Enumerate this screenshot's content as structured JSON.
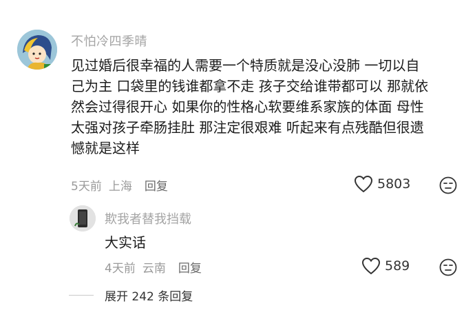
{
  "comment": {
    "username": "不怕冷四季晴",
    "lines": [
      "见过婚后很幸福的人需要一个特质就是没心没肺 一切以自",
      "己为主 口袋里的钱谁都拿不走 孩子交给谁带都可以 那就依",
      "然会过得很开心 如果你的性格心软要维系家族的体面 母性",
      "太强对孩子牵肠挂肚 那注定很艰难 听起来有点残酷但很遗",
      "憾就是这样"
    ],
    "time": "5天前",
    "location": "上海",
    "reply_label": "回复",
    "likes": "5803"
  },
  "reply": {
    "username": "欺我者替我挡载",
    "text": "大实话",
    "time": "4天前",
    "location": "云南",
    "reply_label": "回复",
    "likes": "589"
  },
  "expand_label": "展开 242 条回复",
  "icons": {
    "like": "heart-icon",
    "dislike": "frown-face-icon"
  },
  "colors": {
    "meta_gray": "#9a9a9a",
    "text": "#1c1c1c"
  }
}
